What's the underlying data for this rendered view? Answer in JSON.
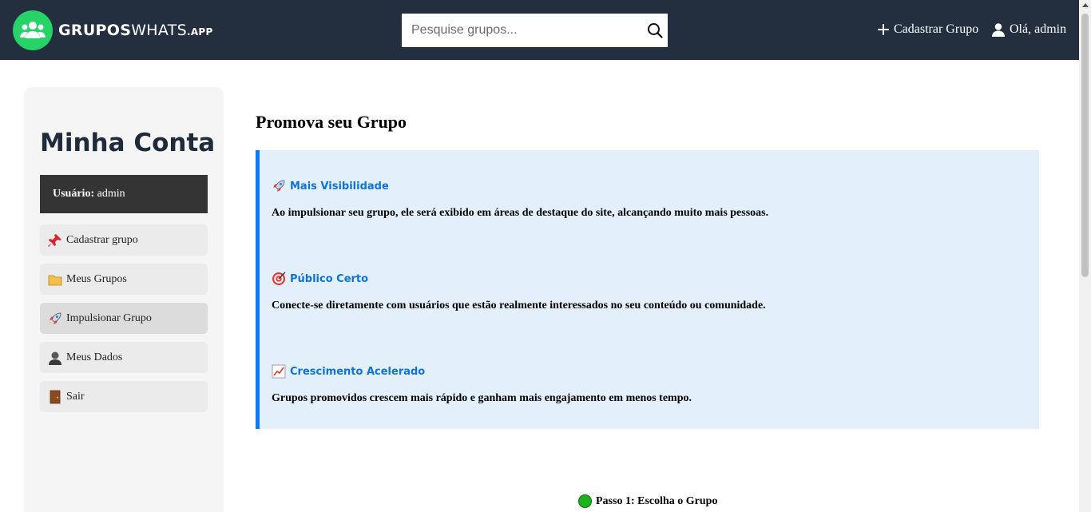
{
  "header": {
    "logo_part1": "GRUPOS",
    "logo_part2": "WHATS",
    "logo_part3": ".APP",
    "search_placeholder": "Pesquise grupos...",
    "add_group_label": "Cadastrar Grupo",
    "greeting_label": "Olá, admin"
  },
  "sidebar": {
    "title": "Minha Conta",
    "user_label": "Usuário:",
    "user_value": "admin",
    "items": [
      {
        "label": "Cadastrar grupo",
        "icon": "pushpin-icon"
      },
      {
        "label": "Meus Grupos",
        "icon": "folder-icon"
      },
      {
        "label": "Impulsionar Grupo",
        "icon": "rocket-icon"
      },
      {
        "label": "Meus Dados",
        "icon": "user-icon"
      },
      {
        "label": "Sair",
        "icon": "door-icon"
      }
    ],
    "active_index": 2
  },
  "main": {
    "title": "Promova seu Grupo",
    "benefits": [
      {
        "title": "Mais Visibilidade",
        "icon": "rocket-icon",
        "text": "Ao impulsionar seu grupo, ele será exibido em áreas de destaque do site, alcançando muito mais pessoas."
      },
      {
        "title": "Público Certo",
        "icon": "target-icon",
        "text": "Conecte-se diretamente com usuários que estão realmente interessados no seu conteúdo ou comunidade."
      },
      {
        "title": "Crescimento Acelerado",
        "icon": "chart-increasing-icon",
        "text": "Grupos promovidos crescem mais rápido e ganham mais engajamento em menos tempo."
      }
    ],
    "step_label": "Passo 1: Escolha o Grupo"
  },
  "colors": {
    "header_bg": "#232e3f",
    "brand_green": "#25d366",
    "accent_blue": "#0a7cf0",
    "benefit_bg": "#e3f0fb",
    "step_dot": "#1fb21f"
  }
}
